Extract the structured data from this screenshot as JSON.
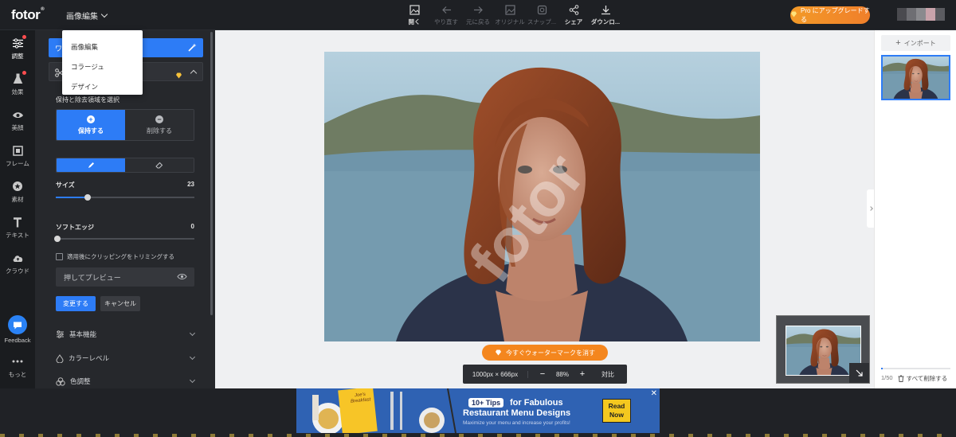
{
  "app": {
    "logo": "fotor",
    "logo_mark": "®",
    "menu_label": "画像編集"
  },
  "menu_dropdown": {
    "items": [
      "画像編集",
      "コラージュ",
      "デザイン"
    ]
  },
  "toolbar": {
    "items": [
      {
        "label": "開く",
        "icon": "open-image-icon",
        "enabled": true
      },
      {
        "label": "やり直す",
        "icon": "undo-icon",
        "enabled": false
      },
      {
        "label": "元に戻る",
        "icon": "redo-icon",
        "enabled": false
      },
      {
        "label": "オリジナル",
        "icon": "original-icon",
        "enabled": false
      },
      {
        "label": "スナップ...",
        "icon": "snapshot-icon",
        "enabled": false
      },
      {
        "label": "シェア",
        "icon": "share-icon",
        "enabled": true
      },
      {
        "label": "ダウンロ...",
        "icon": "download-icon",
        "enabled": true
      }
    ],
    "pro_button": "Pro にアップグレードする"
  },
  "rail": {
    "items": [
      {
        "label": "調整",
        "icon": "sliders-icon",
        "badge": true
      },
      {
        "label": "効果",
        "icon": "flask-icon",
        "badge": true
      },
      {
        "label": "美顔",
        "icon": "eye-icon",
        "badge": false
      },
      {
        "label": "フレーム",
        "icon": "frame-icon",
        "badge": false
      },
      {
        "label": "素材",
        "icon": "sticker-icon",
        "badge": false
      },
      {
        "label": "テキスト",
        "icon": "text-icon",
        "badge": false
      },
      {
        "label": "クラウド",
        "icon": "cloud-icon",
        "badge": false
      }
    ],
    "feedback": "Feedback",
    "more": "もっと"
  },
  "panel": {
    "top_tab": "ワ",
    "select_area_label": "保持と除去領域を選択",
    "keep_label": "保持する",
    "remove_label": "削除する",
    "size_label": "サイズ",
    "size_value": "23",
    "size_fraction": 0.23,
    "softedge_label": "ソフトエッジ",
    "softedge_value": "0",
    "trim_label": "適用後にクリッピングをトリミングする",
    "preview_label": "押してプレビュー",
    "apply_label": "変更する",
    "cancel_label": "キャンセル",
    "accordions": [
      "基本機能",
      "カラーレベル",
      "色調整"
    ]
  },
  "canvas": {
    "watermark": "fotor",
    "remove_watermark_button": "今すぐウォーターマークを消す",
    "dimensions": "1000px × 666px",
    "zoom": "88%",
    "fit_label": "対比"
  },
  "right_panel": {
    "import_label": "インポート",
    "count": "1/50",
    "delete_all": "すべて削除する"
  },
  "ad": {
    "tips_badge": "10+ Tips",
    "headline_1": "for Fabulous",
    "headline_2": "Restaurant Menu Designs",
    "subline": "Maximize your menu and increase your profits!",
    "cta": "Read Now",
    "menu_card": "Joe's Breakfast"
  },
  "colors": {
    "accent": "#2d7cf6",
    "pro": "#f39a28",
    "badge": "#ff4d4f",
    "watermark_button": "#f4861e"
  }
}
